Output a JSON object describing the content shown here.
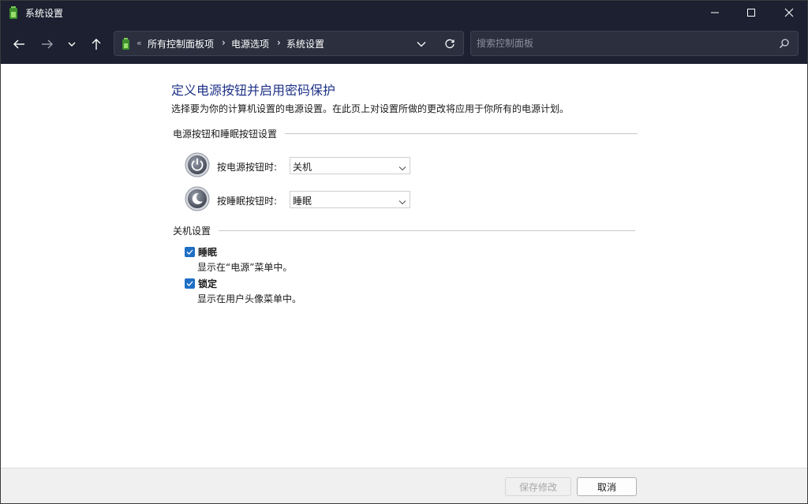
{
  "window": {
    "title": "系统设置",
    "controls": {
      "minimize": "minimize-icon",
      "maximize": "maximize-icon",
      "close": "close-icon"
    }
  },
  "nav": {
    "back_icon": "arrow-left-icon",
    "forward_icon": "arrow-right-icon",
    "recent_icon": "chevron-down-icon",
    "up_icon": "arrow-up-icon",
    "overflow": "«",
    "breadcrumbs": [
      "所有控制面板项",
      "电源选项",
      "系统设置"
    ],
    "separator": "›",
    "search_placeholder": "搜索控制面板"
  },
  "main": {
    "title": "定义电源按钮并启用密码保护",
    "description": "选择要为你的计算机设置的电源设置。在此页上对设置所做的更改将应用于你所有的电源计划。",
    "button_group": {
      "heading": "电源按钮和睡眠按钮设置",
      "items": [
        {
          "icon": "power-button-icon",
          "label": "按电源按钮时:",
          "value": "关机"
        },
        {
          "icon": "sleep-button-icon",
          "label": "按睡眠按钮时:",
          "value": "睡眠"
        }
      ]
    },
    "shutdown_group": {
      "heading": "关机设置",
      "items": [
        {
          "checked": true,
          "title": "睡眠",
          "description": "显示在“电源”菜单中。"
        },
        {
          "checked": true,
          "title": "锁定",
          "description": "显示在用户头像菜单中。"
        }
      ]
    }
  },
  "footer": {
    "save_label": "保存修改",
    "cancel_label": "取消"
  },
  "colors": {
    "titlebar": "#1c2030",
    "title_text": "#1e3287",
    "checkbox": "#1f6fc5"
  }
}
